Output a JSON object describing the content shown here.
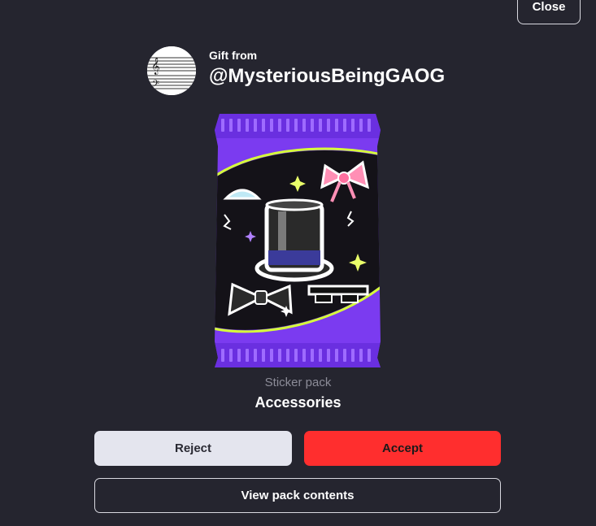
{
  "dialog": {
    "close_label": "Close"
  },
  "sender": {
    "gift_from_label": "Gift from",
    "username": "@MysteriousBeingGAOG",
    "avatar_icon": "sheet-music-icon"
  },
  "pack": {
    "type_label": "Sticker pack",
    "name": "Accessories",
    "art_icons": [
      "top-hat-icon",
      "bow-ribbon-icon",
      "bow-tie-icon",
      "tiara-icon",
      "pixel-sunglasses-icon",
      "sparkle-icon"
    ],
    "colors": {
      "wrapper": "#7b3bf0",
      "inner": "#141218",
      "accent_line": "#d6ff3a"
    }
  },
  "actions": {
    "reject_label": "Reject",
    "accept_label": "Accept",
    "view_contents_label": "View pack contents"
  },
  "colors": {
    "background": "#25252f",
    "accept": "#ff2e2e",
    "reject": "#e4e5ee"
  }
}
